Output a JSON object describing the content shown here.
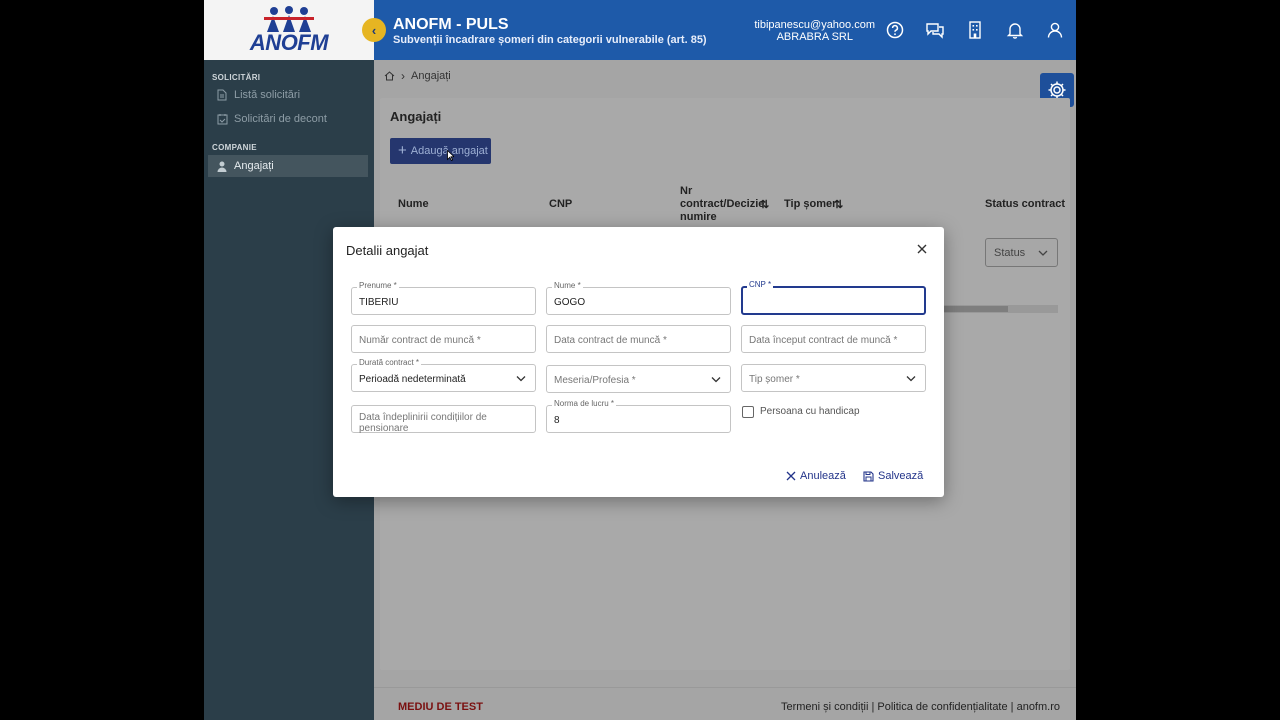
{
  "header": {
    "logo_text": "ANOFM",
    "title": "ANOFM - PULS",
    "subtitle": "Subvenții încadrare șomeri din categorii vulnerabile (art. 85)",
    "user_email": "tibipanescu@yahoo.com",
    "company": "ABRABRA SRL",
    "icons": [
      "help-icon",
      "chat-icon",
      "building-icon",
      "bell-icon",
      "user-icon"
    ],
    "color": "#1e5aa9"
  },
  "sidebar": {
    "sections": [
      {
        "title": "SOLICITĂRI",
        "items": [
          {
            "label": "Listă solicitări",
            "icon": "document-icon"
          },
          {
            "label": "Solicitări de decont",
            "icon": "calendar-check-icon"
          }
        ]
      },
      {
        "title": "COMPANIE",
        "items": [
          {
            "label": "Angajați",
            "icon": "person-icon",
            "active": true
          }
        ]
      }
    ]
  },
  "breadcrumb": {
    "current": "Angajați"
  },
  "page": {
    "title": "Angajați",
    "add_button": "Adaugă angajat",
    "table_headers": {
      "name": "Nume",
      "cnp": "CNP",
      "contract": "Nr contract/Decizie numire",
      "tip_somer": "Tip șomer",
      "status_contract": "Status contract"
    },
    "status_filter": "Status"
  },
  "footer": {
    "env": "MEDIU DE TEST",
    "links": "Termeni și condiții | Politica de confidențialitate | anofm.ro"
  },
  "modal": {
    "title": "Detalii angajat",
    "fields": {
      "prenume": {
        "label": "Prenume *",
        "value": "TIBERIU"
      },
      "nume": {
        "label": "Nume *",
        "value": "GOGO"
      },
      "cnp": {
        "label": "CNP *",
        "value": ""
      },
      "nr_contract": {
        "placeholder": "Număr contract de muncă *"
      },
      "data_contract": {
        "placeholder": "Data contract de muncă *"
      },
      "data_inceput": {
        "placeholder": "Data început contract de muncă *"
      },
      "durata": {
        "label": "Durată contract *",
        "value": "Perioadă nedeterminată"
      },
      "meserie": {
        "placeholder": "Meseria/Profesia *"
      },
      "tip_somer": {
        "placeholder": "Tip șomer *"
      },
      "data_pensionare": {
        "placeholder": "Data îndeplinirii condițiilor de pensionare"
      },
      "norma": {
        "label": "Norma de lucru *",
        "value": "8"
      },
      "handicap": {
        "label": "Persoana cu handicap",
        "checked": false
      }
    },
    "cancel": "Anulează",
    "save": "Salvează"
  }
}
